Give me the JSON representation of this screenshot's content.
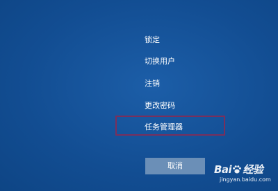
{
  "menu": {
    "items": [
      {
        "label": "锁定"
      },
      {
        "label": "切换用户"
      },
      {
        "label": "注销"
      },
      {
        "label": "更改密码"
      },
      {
        "label": "任务管理器"
      }
    ]
  },
  "cancel_button": {
    "label": "取消"
  },
  "watermark": {
    "logo_prefix": "Bai",
    "logo_suffix": "经验",
    "url": "jingyan.baidu.com"
  },
  "colors": {
    "background": "#124d92",
    "highlight_border": "#7a2f5c",
    "button": "#6b8fb7",
    "text": "#ffffff"
  }
}
